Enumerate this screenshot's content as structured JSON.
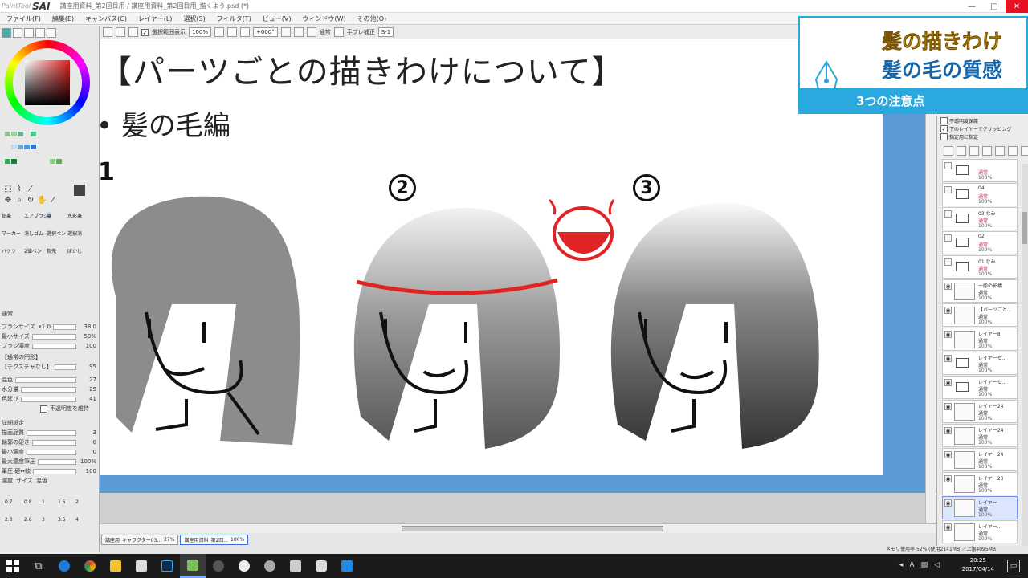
{
  "window": {
    "app_name": "SAI",
    "logo_prefix": "PaintTool",
    "title": "講座用資料_第2回目用 / 講座用資料_第2回目用_描くよう.psd (*)",
    "controls": [
      "—",
      "□",
      "✕"
    ]
  },
  "menu": [
    "ファイル(F)",
    "編集(E)",
    "キャンバス(C)",
    "レイヤー(L)",
    "選択(S)",
    "フィルタ(T)",
    "ビュー(V)",
    "ウィンドウ(W)",
    "その他(O)"
  ],
  "toolbar": {
    "antialias_label": "選択範囲表示",
    "zoom": "100%",
    "rotation": "+000°",
    "blend_label": "通常",
    "stabilizer_label": "手ブレ補正",
    "stabilizer_value": "S-1"
  },
  "slide": {
    "heading": "【パーツごとの描きわけについて】",
    "bullet": "• 髪の毛編",
    "numbers": [
      "1",
      "2",
      "3"
    ]
  },
  "overlay": {
    "line1": "髪の描きわけ",
    "line2": "髪の毛の質感",
    "label": "3つの注意点",
    "line1_color": "#f2c230",
    "line2_color": "#1565a8",
    "banner_color": "#2aa9e0"
  },
  "tool_panel": {
    "tools": [
      "鉛筆",
      "エアブラシ",
      "筆",
      "水彩筆",
      "マーカー",
      "消しゴム",
      "選択ペン",
      "選択消",
      "バケツ",
      "2値ペン",
      "指先",
      "ぼかし"
    ],
    "blend_mode": "通常",
    "brush_size_label": "ブラシサイズ",
    "brush_size_multiplier": "x1.0",
    "brush_size": "38.0",
    "min_size_label": "最小サイズ",
    "min_size": "50%",
    "density_label": "ブラシ濃度",
    "density": "100",
    "shape_label": "【通常の円形】",
    "texture_label": "【テクスチャなし】",
    "texture_strength": "95",
    "blend_label": "混色",
    "blend": "27",
    "water_label": "水分量",
    "water": "25",
    "persistence_label": "色延び",
    "persistence": "41",
    "keep_opacity_label": "不透明度を維持",
    "detail_label": "詳細設定",
    "quality_label": "描画品質",
    "quality": "3",
    "edge_label": "輪郭の硬さ",
    "edge": "0",
    "min_density_label": "最小濃度",
    "min_density": "0",
    "max_density_label": "最大濃度筆圧",
    "max_density": "100%",
    "pressure_label": "筆圧 硬↔軟",
    "pressure": "100",
    "pressure_opts": [
      "濃度",
      "サイズ",
      "混色"
    ],
    "size_presets": [
      "0.7",
      "0.8",
      "1",
      "1.5",
      "2",
      "2.3",
      "2.6",
      "3",
      "3.5",
      "4"
    ]
  },
  "layer_panel": {
    "checks": [
      "不透明度保護",
      "下のレイヤーでクリッピング",
      "指定用に指定"
    ],
    "layers": [
      {
        "name": "",
        "mode": "通常",
        "opacity": "100%",
        "folder": true
      },
      {
        "name": "04",
        "mode": "通常",
        "opacity": "100%",
        "folder": true
      },
      {
        "name": "03 なみ",
        "mode": "通常",
        "opacity": "100%",
        "folder": true
      },
      {
        "name": "02",
        "mode": "通常",
        "opacity": "100%",
        "folder": true
      },
      {
        "name": "01 なみ",
        "mode": "通常",
        "opacity": "100%",
        "folder": true
      },
      {
        "name": "一般の影構",
        "mode": "通常",
        "opacity": "100%",
        "folder": false
      },
      {
        "name": "【パーツごと...",
        "mode": "通常",
        "opacity": "100%",
        "folder": false
      },
      {
        "name": "レイヤー8",
        "mode": "通常",
        "opacity": "100%",
        "folder": false
      },
      {
        "name": "レイヤーセ...",
        "mode": "通常",
        "opacity": "100%",
        "folder": true
      },
      {
        "name": "レイヤーセ...",
        "mode": "通常",
        "opacity": "100%",
        "folder": true
      },
      {
        "name": "レイヤー24",
        "mode": "通常",
        "opacity": "100%",
        "folder": false
      },
      {
        "name": "レイヤー24",
        "mode": "通常",
        "opacity": "100%",
        "folder": false
      },
      {
        "name": "レイヤー24",
        "mode": "通常",
        "opacity": "100%",
        "folder": false
      },
      {
        "name": "レイヤー23",
        "mode": "通常",
        "opacity": "100%",
        "folder": false
      },
      {
        "name": "レイヤー",
        "mode": "通常",
        "opacity": "100%",
        "folder": false
      },
      {
        "name": "レイヤー...",
        "mode": "通常",
        "opacity": "100%",
        "folder": false
      }
    ]
  },
  "doc_tabs": [
    {
      "name": "講座用_キャラクター03...",
      "zoom": "27%"
    },
    {
      "name": "講座用資料_第2回...",
      "zoom": "100%"
    }
  ],
  "status": "メモリ使用率 52% (使用2141MB)／上限4095MB",
  "taskbar": {
    "time": "20:25",
    "date": "2017/04/14",
    "ime": "A"
  }
}
